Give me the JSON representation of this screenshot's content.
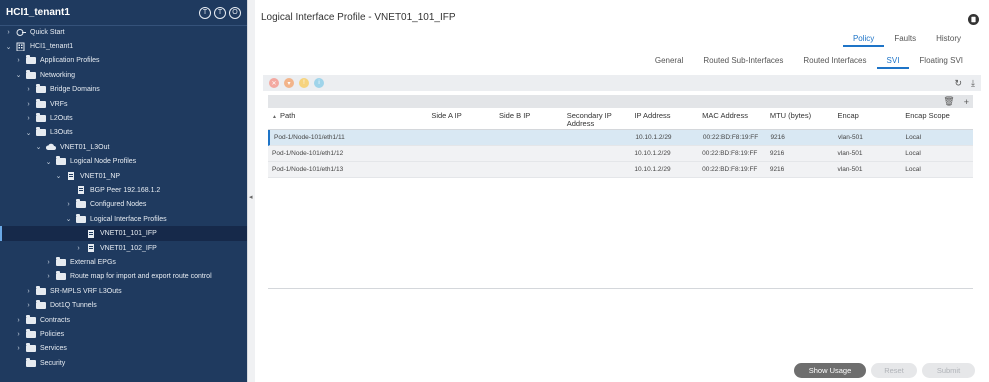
{
  "sidebar": {
    "title": "HCI1_tenant1",
    "tools": [
      "T",
      "T",
      "O"
    ],
    "items": [
      {
        "label": "Quick Start",
        "indent": 0,
        "caret": ">",
        "icon": "quickstart"
      },
      {
        "label": "HCI1_tenant1",
        "indent": 0,
        "caret": "v",
        "icon": "building"
      },
      {
        "label": "Application Profiles",
        "indent": 1,
        "caret": ">",
        "icon": "folder"
      },
      {
        "label": "Networking",
        "indent": 1,
        "caret": "v",
        "icon": "folder"
      },
      {
        "label": "Bridge Domains",
        "indent": 2,
        "caret": ">",
        "icon": "folder"
      },
      {
        "label": "VRFs",
        "indent": 2,
        "caret": ">",
        "icon": "folder"
      },
      {
        "label": "L2Outs",
        "indent": 2,
        "caret": ">",
        "icon": "folder"
      },
      {
        "label": "L3Outs",
        "indent": 2,
        "caret": "v",
        "icon": "folder"
      },
      {
        "label": "VNET01_L3Out",
        "indent": 3,
        "caret": "v",
        "icon": "cloud"
      },
      {
        "label": "Logical Node Profiles",
        "indent": 4,
        "caret": "v",
        "icon": "folder"
      },
      {
        "label": "VNET01_NP",
        "indent": 5,
        "caret": "v",
        "icon": "doc"
      },
      {
        "label": "BGP Peer 192.168.1.2",
        "indent": 6,
        "caret": "",
        "icon": "doc"
      },
      {
        "label": "Configured Nodes",
        "indent": 6,
        "caret": ">",
        "icon": "folder"
      },
      {
        "label": "Logical Interface Profiles",
        "indent": 6,
        "caret": "v",
        "icon": "folder"
      },
      {
        "label": "VNET01_101_IFP",
        "indent": 7,
        "caret": "",
        "icon": "doc",
        "selected": true
      },
      {
        "label": "VNET01_102_IFP",
        "indent": 7,
        "caret": ">",
        "icon": "doc"
      },
      {
        "label": "External EPGs",
        "indent": 4,
        "caret": ">",
        "icon": "folder"
      },
      {
        "label": "Route map for import and export route control",
        "indent": 4,
        "caret": ">",
        "icon": "folder"
      },
      {
        "label": "SR-MPLS VRF L3Outs",
        "indent": 2,
        "caret": ">",
        "icon": "folder"
      },
      {
        "label": "Dot1Q Tunnels",
        "indent": 2,
        "caret": ">",
        "icon": "folder"
      },
      {
        "label": "Contracts",
        "indent": 1,
        "caret": ">",
        "icon": "folder"
      },
      {
        "label": "Policies",
        "indent": 1,
        "caret": ">",
        "icon": "folder"
      },
      {
        "label": "Services",
        "indent": 1,
        "caret": ">",
        "icon": "folder"
      },
      {
        "label": "Security",
        "indent": 1,
        "caret": "",
        "icon": "folder"
      }
    ]
  },
  "main": {
    "title": "Logical Interface Profile - VNET01_101_IFP",
    "top_tabs": [
      {
        "label": "Policy",
        "active": true
      },
      {
        "label": "Faults",
        "active": false
      },
      {
        "label": "History",
        "active": false
      }
    ],
    "sub_tabs": [
      {
        "label": "General",
        "active": false
      },
      {
        "label": "Routed Sub-Interfaces",
        "active": false
      },
      {
        "label": "Routed Interfaces",
        "active": false
      },
      {
        "label": "SVI",
        "active": true
      },
      {
        "label": "Floating SVI",
        "active": false
      }
    ],
    "toolbar_colors": [
      "#f3a8a0",
      "#f2b48a",
      "#f6d37e",
      "#9fd4ea"
    ],
    "table": {
      "headers": [
        "Path",
        "Side A IP",
        "Side B IP",
        "Secondary IP Address",
        "IP Address",
        "MAC Address",
        "MTU (bytes)",
        "Encap",
        "Encap Scope"
      ],
      "sort_indicator": "▲",
      "rows": [
        [
          "Pod-1/Node-101/eth1/11",
          "",
          "",
          "",
          "10.10.1.2/29",
          "00:22:BD:F8:19:FF",
          "9216",
          "vlan-501",
          "Local"
        ],
        [
          "Pod-1/Node-101/eth1/12",
          "",
          "",
          "",
          "10.10.1.2/29",
          "00:22:BD:F8:19:FF",
          "9216",
          "vlan-501",
          "Local"
        ],
        [
          "Pod-1/Node-101/eth1/13",
          "",
          "",
          "",
          "10.10.1.2/29",
          "00:22:BD:F8:19:FF",
          "9216",
          "vlan-501",
          "Local"
        ]
      ]
    },
    "buttons": {
      "show_usage": "Show Usage",
      "reset": "Reset",
      "submit": "Submit"
    }
  }
}
